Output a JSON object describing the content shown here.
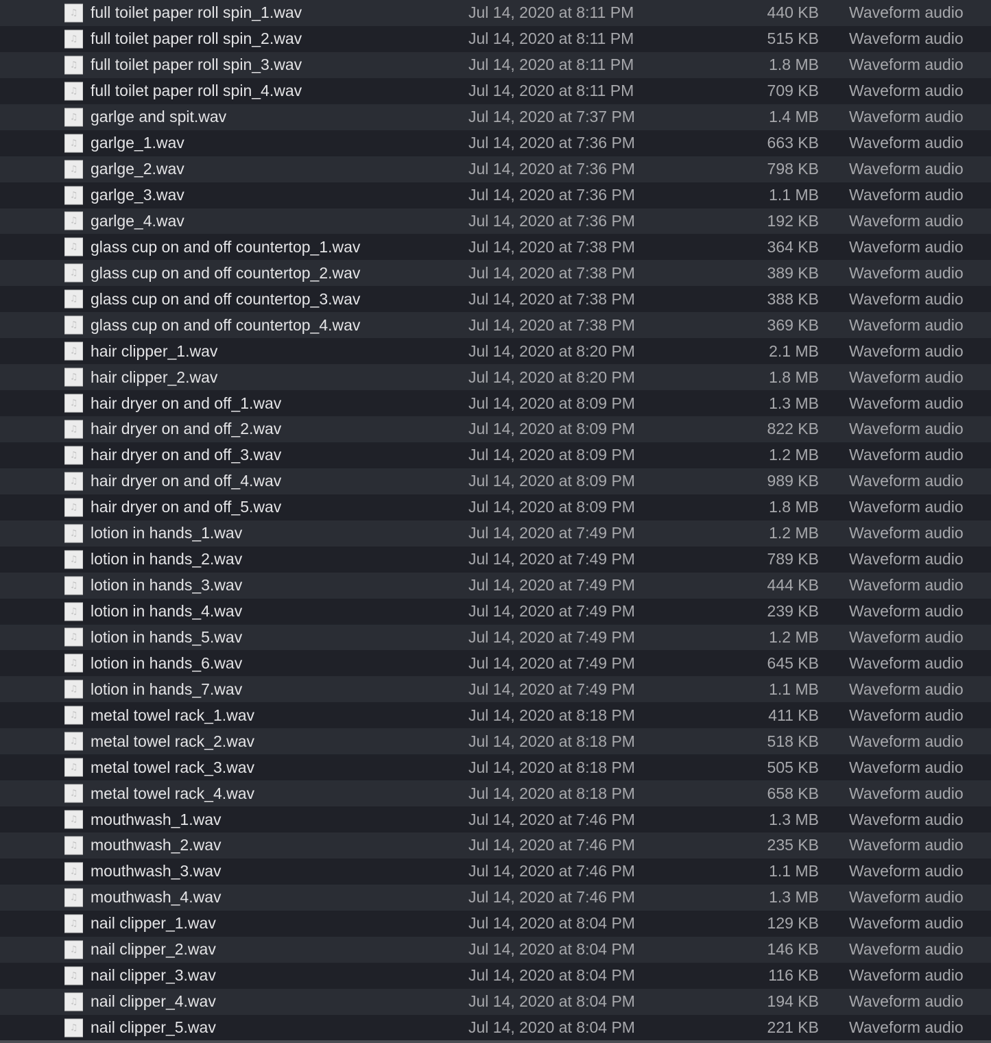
{
  "file_icon": "audio-file-icon",
  "files": [
    {
      "name": "full toilet paper roll spin_1.wav",
      "date": "Jul 14, 2020 at 8:11 PM",
      "size": "440 KB",
      "kind": "Waveform audio"
    },
    {
      "name": "full toilet paper roll spin_2.wav",
      "date": "Jul 14, 2020 at 8:11 PM",
      "size": "515 KB",
      "kind": "Waveform audio"
    },
    {
      "name": "full toilet paper roll spin_3.wav",
      "date": "Jul 14, 2020 at 8:11 PM",
      "size": "1.8 MB",
      "kind": "Waveform audio"
    },
    {
      "name": "full toilet paper roll spin_4.wav",
      "date": "Jul 14, 2020 at 8:11 PM",
      "size": "709 KB",
      "kind": "Waveform audio"
    },
    {
      "name": "garlge and spit.wav",
      "date": "Jul 14, 2020 at 7:37 PM",
      "size": "1.4 MB",
      "kind": "Waveform audio"
    },
    {
      "name": "garlge_1.wav",
      "date": "Jul 14, 2020 at 7:36 PM",
      "size": "663 KB",
      "kind": "Waveform audio"
    },
    {
      "name": "garlge_2.wav",
      "date": "Jul 14, 2020 at 7:36 PM",
      "size": "798 KB",
      "kind": "Waveform audio"
    },
    {
      "name": "garlge_3.wav",
      "date": "Jul 14, 2020 at 7:36 PM",
      "size": "1.1 MB",
      "kind": "Waveform audio"
    },
    {
      "name": "garlge_4.wav",
      "date": "Jul 14, 2020 at 7:36 PM",
      "size": "192 KB",
      "kind": "Waveform audio"
    },
    {
      "name": "glass cup on and off countertop_1.wav",
      "date": "Jul 14, 2020 at 7:38 PM",
      "size": "364 KB",
      "kind": "Waveform audio"
    },
    {
      "name": "glass cup on and off countertop_2.wav",
      "date": "Jul 14, 2020 at 7:38 PM",
      "size": "389 KB",
      "kind": "Waveform audio"
    },
    {
      "name": "glass cup on and off countertop_3.wav",
      "date": "Jul 14, 2020 at 7:38 PM",
      "size": "388 KB",
      "kind": "Waveform audio"
    },
    {
      "name": "glass cup on and off countertop_4.wav",
      "date": "Jul 14, 2020 at 7:38 PM",
      "size": "369 KB",
      "kind": "Waveform audio"
    },
    {
      "name": "hair clipper_1.wav",
      "date": "Jul 14, 2020 at 8:20 PM",
      "size": "2.1 MB",
      "kind": "Waveform audio"
    },
    {
      "name": "hair clipper_2.wav",
      "date": "Jul 14, 2020 at 8:20 PM",
      "size": "1.8 MB",
      "kind": "Waveform audio"
    },
    {
      "name": "hair dryer on and off_1.wav",
      "date": "Jul 14, 2020 at 8:09 PM",
      "size": "1.3 MB",
      "kind": "Waveform audio"
    },
    {
      "name": "hair dryer on and off_2.wav",
      "date": "Jul 14, 2020 at 8:09 PM",
      "size": "822 KB",
      "kind": "Waveform audio"
    },
    {
      "name": "hair dryer on and off_3.wav",
      "date": "Jul 14, 2020 at 8:09 PM",
      "size": "1.2 MB",
      "kind": "Waveform audio"
    },
    {
      "name": "hair dryer on and off_4.wav",
      "date": "Jul 14, 2020 at 8:09 PM",
      "size": "989 KB",
      "kind": "Waveform audio"
    },
    {
      "name": "hair dryer on and off_5.wav",
      "date": "Jul 14, 2020 at 8:09 PM",
      "size": "1.8 MB",
      "kind": "Waveform audio"
    },
    {
      "name": "lotion in hands_1.wav",
      "date": "Jul 14, 2020 at 7:49 PM",
      "size": "1.2 MB",
      "kind": "Waveform audio"
    },
    {
      "name": "lotion in hands_2.wav",
      "date": "Jul 14, 2020 at 7:49 PM",
      "size": "789 KB",
      "kind": "Waveform audio"
    },
    {
      "name": "lotion in hands_3.wav",
      "date": "Jul 14, 2020 at 7:49 PM",
      "size": "444 KB",
      "kind": "Waveform audio"
    },
    {
      "name": "lotion in hands_4.wav",
      "date": "Jul 14, 2020 at 7:49 PM",
      "size": "239 KB",
      "kind": "Waveform audio"
    },
    {
      "name": "lotion in hands_5.wav",
      "date": "Jul 14, 2020 at 7:49 PM",
      "size": "1.2 MB",
      "kind": "Waveform audio"
    },
    {
      "name": "lotion in hands_6.wav",
      "date": "Jul 14, 2020 at 7:49 PM",
      "size": "645 KB",
      "kind": "Waveform audio"
    },
    {
      "name": "lotion in hands_7.wav",
      "date": "Jul 14, 2020 at 7:49 PM",
      "size": "1.1 MB",
      "kind": "Waveform audio"
    },
    {
      "name": "metal towel rack_1.wav",
      "date": "Jul 14, 2020 at 8:18 PM",
      "size": "411 KB",
      "kind": "Waveform audio"
    },
    {
      "name": "metal towel rack_2.wav",
      "date": "Jul 14, 2020 at 8:18 PM",
      "size": "518 KB",
      "kind": "Waveform audio"
    },
    {
      "name": "metal towel rack_3.wav",
      "date": "Jul 14, 2020 at 8:18 PM",
      "size": "505 KB",
      "kind": "Waveform audio"
    },
    {
      "name": "metal towel rack_4.wav",
      "date": "Jul 14, 2020 at 8:18 PM",
      "size": "658 KB",
      "kind": "Waveform audio"
    },
    {
      "name": "mouthwash_1.wav",
      "date": "Jul 14, 2020 at 7:46 PM",
      "size": "1.3 MB",
      "kind": "Waveform audio"
    },
    {
      "name": "mouthwash_2.wav",
      "date": "Jul 14, 2020 at 7:46 PM",
      "size": "235 KB",
      "kind": "Waveform audio"
    },
    {
      "name": "mouthwash_3.wav",
      "date": "Jul 14, 2020 at 7:46 PM",
      "size": "1.1 MB",
      "kind": "Waveform audio"
    },
    {
      "name": "mouthwash_4.wav",
      "date": "Jul 14, 2020 at 7:46 PM",
      "size": "1.3 MB",
      "kind": "Waveform audio"
    },
    {
      "name": "nail clipper_1.wav",
      "date": "Jul 14, 2020 at 8:04 PM",
      "size": "129 KB",
      "kind": "Waveform audio"
    },
    {
      "name": "nail clipper_2.wav",
      "date": "Jul 14, 2020 at 8:04 PM",
      "size": "146 KB",
      "kind": "Waveform audio"
    },
    {
      "name": "nail clipper_3.wav",
      "date": "Jul 14, 2020 at 8:04 PM",
      "size": "116 KB",
      "kind": "Waveform audio"
    },
    {
      "name": "nail clipper_4.wav",
      "date": "Jul 14, 2020 at 8:04 PM",
      "size": "194 KB",
      "kind": "Waveform audio"
    },
    {
      "name": "nail clipper_5.wav",
      "date": "Jul 14, 2020 at 8:04 PM",
      "size": "221 KB",
      "kind": "Waveform audio"
    }
  ],
  "icon_glyph": "♫"
}
